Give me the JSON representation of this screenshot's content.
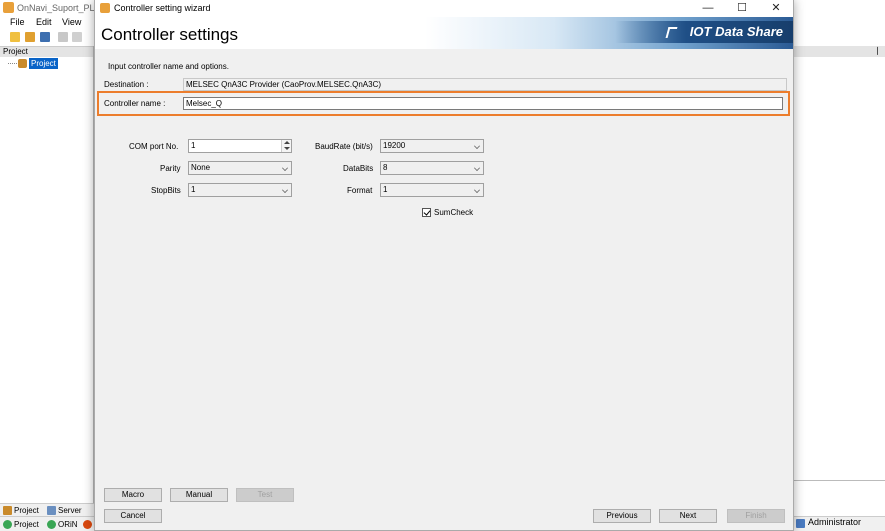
{
  "app": {
    "title": "OnNavi_Suport_PLC_M",
    "menu": [
      "File",
      "Edit",
      "View"
    ],
    "panel_header": "Project",
    "tree_item": "Project",
    "bottom_tabs": [
      "Project",
      "Server"
    ],
    "status_items": [
      "Project",
      "ORiN"
    ],
    "user": "Administrator",
    "pin_glyph": "❘"
  },
  "dialog": {
    "window_title": "Controller setting wizard",
    "minimize_glyph": "—",
    "maximize_glyph": "☐",
    "close_glyph": "✕",
    "heading": "Controller settings",
    "brand": "IOT Data Share",
    "instruction": "Input controller name and options.",
    "destination_label": "Destination :",
    "destination_value": "MELSEC QnA3C Provider (CaoProv.MELSEC.QnA3C)",
    "controller_name_label": "Controller name :",
    "controller_name_value": "Melsec_Q",
    "options": {
      "com_port_label": "COM port No.",
      "com_port_value": "1",
      "parity_label": "Parity",
      "parity_value": "None",
      "stopbits_label": "StopBits",
      "stopbits_value": "1",
      "baudrate_label": "BaudRate (bit/s)",
      "baudrate_value": "19200",
      "databits_label": "DataBits",
      "databits_value": "8",
      "format_label": "Format",
      "format_value": "1",
      "sumcheck_label": "SumCheck",
      "sumcheck_checked": true
    },
    "buttons": {
      "macro": "Macro",
      "manual": "Manual",
      "test": "Test",
      "cancel": "Cancel",
      "previous": "Previous",
      "next": "Next",
      "finish": "Finish"
    }
  },
  "colors": {
    "highlight_border": "#ec7d2c",
    "selection": "#0a64c8",
    "brand_dark": "#1f4f86"
  }
}
